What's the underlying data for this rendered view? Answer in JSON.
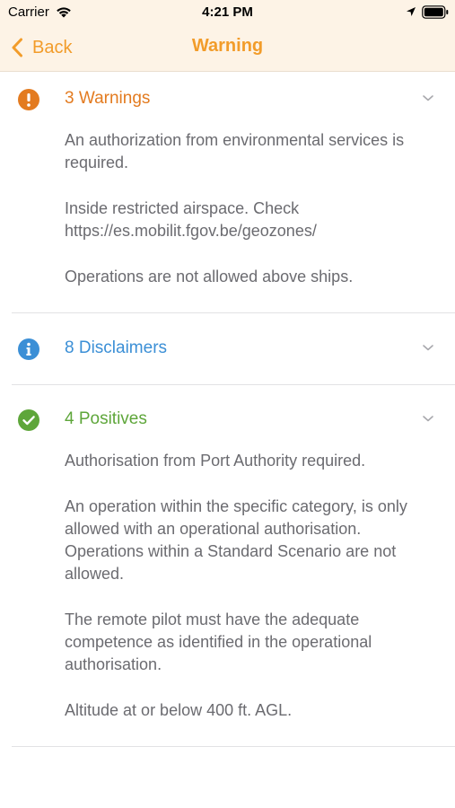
{
  "status_bar": {
    "carrier": "Carrier",
    "time": "4:21 PM"
  },
  "nav": {
    "back_label": "Back",
    "title": "Warning"
  },
  "colors": {
    "accent": "#f29c2a",
    "warning": "#e37b20",
    "info": "#3b8fd6",
    "positive": "#5ea63a",
    "body_text": "#6b6b70"
  },
  "sections": [
    {
      "title": "3 Warnings",
      "icon": "exclamation-circle-icon",
      "expanded": true,
      "items": [
        "An authorization from environmental services is required.",
        "Inside restricted airspace. Check https://es.mobilit.fgov.be/geozones/",
        "Operations are not allowed above ships."
      ]
    },
    {
      "title": "8 Disclaimers",
      "icon": "info-circle-icon",
      "expanded": false,
      "items": []
    },
    {
      "title": "4 Positives",
      "icon": "check-circle-icon",
      "expanded": true,
      "items": [
        "Authorisation from Port Authority required.",
        "An operation within the specific category, is only allowed with an operational authorisation. Operations within a Standard Scenario are not allowed.",
        "The remote pilot must have the adequate competence as identified in the operational authorisation.",
        "Altitude at or below 400 ft. AGL."
      ]
    }
  ]
}
